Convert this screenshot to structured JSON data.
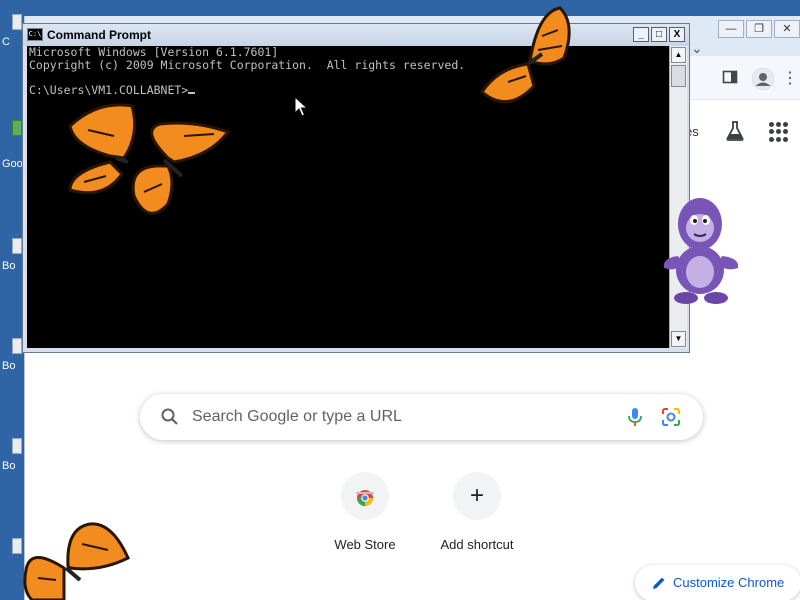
{
  "desktop": {
    "icons": [
      {
        "label": "C",
        "icon": "file-icon"
      },
      {
        "label": "Goo",
        "icon": "shortcut-icon"
      },
      {
        "label": "Bo",
        "icon": "file-icon"
      },
      {
        "label": "Bo",
        "icon": "file-icon"
      },
      {
        "label": "Bo",
        "icon": "file-icon"
      },
      {
        "label": "",
        "icon": "file-icon"
      }
    ]
  },
  "chrome": {
    "window_buttons": {
      "minimize": "—",
      "restore": "❐",
      "close": "✕"
    },
    "tab_list_chevron": "⌄",
    "toolbar": {
      "side_panel_icon": "side-panel-icon",
      "profile_icon": "avatar-icon",
      "menu_icon": "⋮"
    },
    "ntp": {
      "images_link": "es",
      "search_placeholder": "Search Google or type a URL",
      "shortcuts": [
        {
          "label": "Web Store",
          "icon": "chrome-web-store-icon"
        },
        {
          "label": "Add shortcut",
          "icon": "plus-icon",
          "glyph": "+"
        }
      ],
      "customize_label": "Customize Chrome",
      "accent_color": "#0b57d0"
    }
  },
  "cmd": {
    "title": "Command Prompt",
    "icon_text": "C:\\",
    "controls": {
      "minimize": "_",
      "maximize": "□",
      "close": "X"
    },
    "console_lines": [
      "Microsoft Windows [Version 6.1.7601]",
      "Copyright (c) 2009 Microsoft Corporation.  All rights reserved.",
      "",
      "C:\\Users\\VM1.COLLABNET>"
    ],
    "scroll_up": "▲",
    "scroll_down": "▼"
  }
}
